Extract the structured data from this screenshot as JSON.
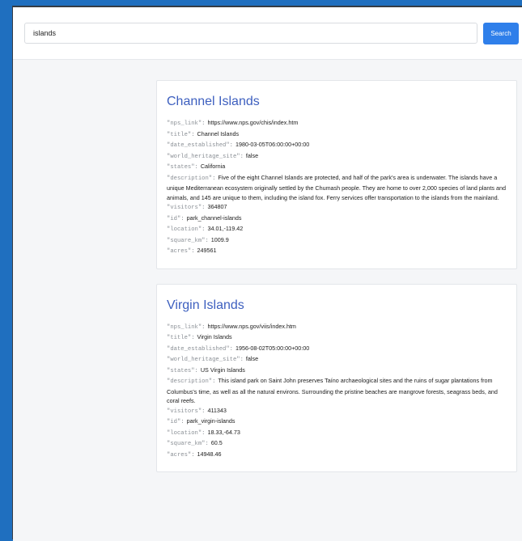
{
  "search": {
    "query": "islands",
    "button_label": "Search"
  },
  "results": [
    {
      "title_heading": "Channel Islands",
      "fields": [
        {
          "key": "\"nps_link\"",
          "value": "https://www.nps.gov/chis/index.htm"
        },
        {
          "key": "\"title\"",
          "value": "Channel Islands"
        },
        {
          "key": "\"date_established\"",
          "value": "1980-03-05T06:00:00+00:00"
        },
        {
          "key": "\"world_heritage_site\"",
          "value": "false"
        },
        {
          "key": "\"states\"",
          "value": "California"
        },
        {
          "key": "\"description\"",
          "value": "Five of the eight Channel Islands are protected, and half of the park's area is underwater. The islands have a unique Mediterranean ecosystem originally settled by the Chumash people. They are home to over 2,000 species of land plants and animals, and 145 are unique to them, including the island fox. Ferry services offer transportation to the islands from the mainland."
        },
        {
          "key": "\"visitors\"",
          "value": "364807"
        },
        {
          "key": "\"id\"",
          "value": "park_channel-islands"
        },
        {
          "key": "\"location\"",
          "value": "34.01,-119.42"
        },
        {
          "key": "\"square_km\"",
          "value": "1009.9"
        },
        {
          "key": "\"acres\"",
          "value": "249561"
        }
      ]
    },
    {
      "title_heading": "Virgin Islands",
      "fields": [
        {
          "key": "\"nps_link\"",
          "value": "https://www.nps.gov/viis/index.htm"
        },
        {
          "key": "\"title\"",
          "value": "Virgin Islands"
        },
        {
          "key": "\"date_established\"",
          "value": "1956-08-02T05:00:00+00:00"
        },
        {
          "key": "\"world_heritage_site\"",
          "value": "false"
        },
        {
          "key": "\"states\"",
          "value": "US Virgin Islands"
        },
        {
          "key": "\"description\"",
          "value": "This island park on Saint John preserves Taíno archaeological sites and the ruins of sugar plantations from Columbus's time, as well as all the natural environs. Surrounding the pristine beaches are mangrove forests, seagrass beds, and coral reefs."
        },
        {
          "key": "\"visitors\"",
          "value": "411343"
        },
        {
          "key": "\"id\"",
          "value": "park_virgin-islands"
        },
        {
          "key": "\"location\"",
          "value": "18.33,-64.73"
        },
        {
          "key": "\"square_km\"",
          "value": "60.5"
        },
        {
          "key": "\"acres\"",
          "value": "14948.46"
        }
      ]
    }
  ]
}
